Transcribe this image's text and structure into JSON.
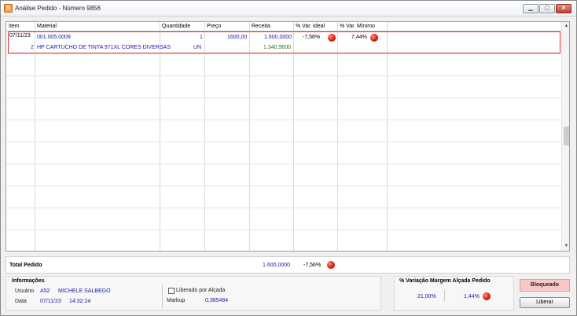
{
  "window": {
    "app_icon": "S",
    "title": "Análise Pedido - Número 9856",
    "min_icon": "minimize-icon",
    "max_icon": "maximize-icon",
    "close_icon": "close-icon",
    "min_glyph": "▁",
    "max_glyph": "▢",
    "close_glyph": "✕"
  },
  "grid": {
    "columns": [
      "Item",
      "Material",
      "Quantidade",
      "Preço",
      "Receita",
      "% Var. Ideal",
      "% Var. Mínimo"
    ],
    "row1": {
      "item": "07/11/23",
      "material": "001.005.0009",
      "quantidade": "1",
      "preco": "1600,00",
      "receita": "1.600,0000",
      "var_ideal": "-7,56%",
      "var_minimo": "7,44%"
    },
    "row2": {
      "item": "2",
      "material": "HP CARTUCHO DE TINTA 971XL CORES DIVERSAS",
      "quantidade": "UN",
      "receita": "1.340,9600"
    },
    "scroll_up": "▲",
    "scroll_down": "▼"
  },
  "total": {
    "label": "Total Pedido",
    "receita": "1.600,0000",
    "var_ideal": "-7,56%"
  },
  "info": {
    "title": "Informações",
    "usuario_label": "Usuário",
    "usuario_code": "A52",
    "usuario_name": "MICHELE SALBEGO",
    "data_label": "Data",
    "data_date": "07/11/23",
    "data_time": "14:32:24",
    "liberado_label": "Liberado por Alçada",
    "markup_label": "Markup",
    "markup_value": "0,385484"
  },
  "margin": {
    "title": "% Variação Margem Alçada Pedido",
    "value1": "21,00%",
    "value2": "1,44%"
  },
  "buttons": {
    "blocked": "Bloqueado",
    "release": "Liberar"
  },
  "colors": {
    "status_red": "#d8200e",
    "value_blue": "#1a1aa8",
    "value_green": "#207520",
    "blocked_bg": "#f8c8c8"
  }
}
